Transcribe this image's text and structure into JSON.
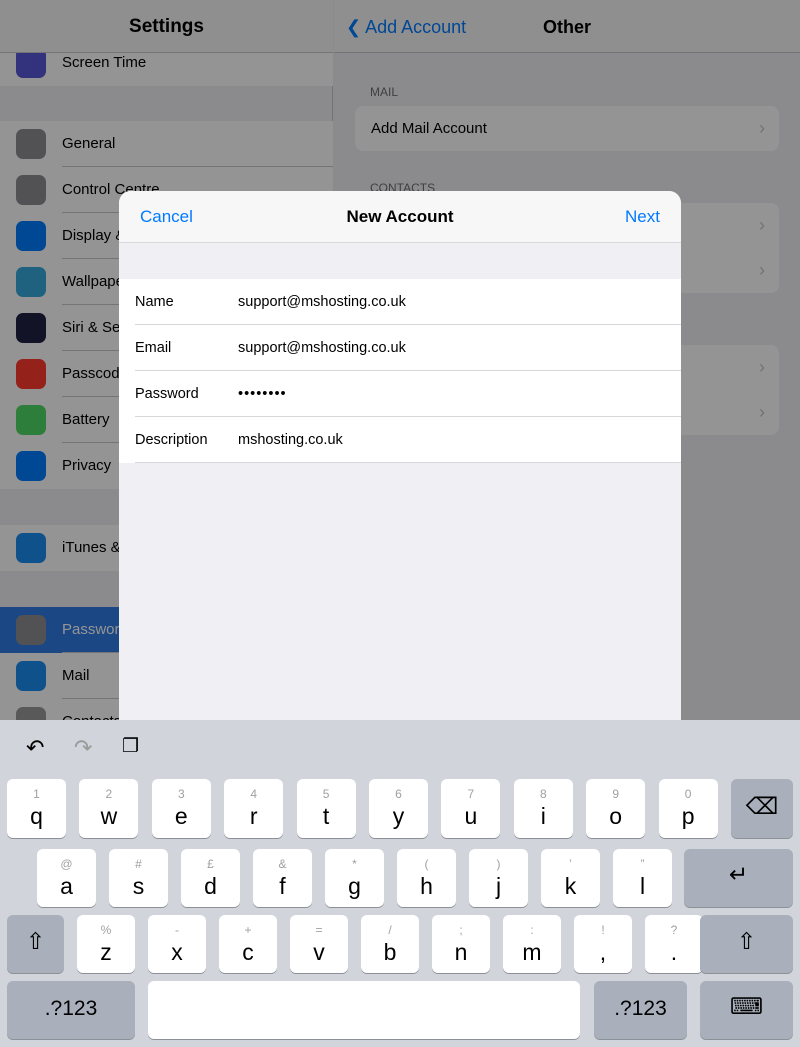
{
  "sidebar": {
    "title": "Settings",
    "items": [
      {
        "label": "Screen Time",
        "icon": "hourglass-icon",
        "color": "#5856d6"
      },
      {
        "label": "General",
        "icon": "gear-icon",
        "color": "#8e8e93"
      },
      {
        "label": "Control Centre",
        "icon": "toggles-icon",
        "color": "#8e8e93"
      },
      {
        "label": "Display & Brightness",
        "icon": "text-size-icon",
        "color": "#007aff"
      },
      {
        "label": "Wallpaper",
        "icon": "flower-icon",
        "color": "#34aadc"
      },
      {
        "label": "Siri & Search",
        "icon": "siri-icon",
        "color": "#222244"
      },
      {
        "label": "Passcode",
        "icon": "lock-icon",
        "color": "#ff3b30"
      },
      {
        "label": "Battery",
        "icon": "battery-icon",
        "color": "#4cd964"
      },
      {
        "label": "Privacy",
        "icon": "hand-icon",
        "color": "#007aff"
      },
      {
        "label": "iTunes & App Store",
        "icon": "app-store-icon",
        "color": "#1a8cf0"
      },
      {
        "label": "Passwords & Accounts",
        "icon": "key-icon",
        "color": "#8e8e93",
        "selected": true
      },
      {
        "label": "Mail",
        "icon": "envelope-icon",
        "color": "#1a8cf0"
      },
      {
        "label": "Contacts",
        "icon": "contacts-icon",
        "color": "#9a9a9a"
      }
    ]
  },
  "detail": {
    "back_label": "Add Account",
    "title": "Other",
    "mail_section": "MAIL",
    "add_mail": "Add Mail Account",
    "contacts_section": "CONTACTS"
  },
  "modal": {
    "cancel": "Cancel",
    "title": "New Account",
    "next": "Next",
    "fields": [
      {
        "label": "Name",
        "value": "support@mshosting.co.uk"
      },
      {
        "label": "Email",
        "value": "support@mshosting.co.uk"
      },
      {
        "label": "Password",
        "value": "••••••••"
      },
      {
        "label": "Description",
        "value": "mshosting.co.uk"
      }
    ]
  },
  "keyboard": {
    "row1": [
      [
        "1",
        "q"
      ],
      [
        "2",
        "w"
      ],
      [
        "3",
        "e"
      ],
      [
        "4",
        "r"
      ],
      [
        "5",
        "t"
      ],
      [
        "6",
        "y"
      ],
      [
        "7",
        "u"
      ],
      [
        "8",
        "i"
      ],
      [
        "9",
        "o"
      ],
      [
        "0",
        "p"
      ]
    ],
    "row2": [
      [
        "@",
        "a"
      ],
      [
        "#",
        "s"
      ],
      [
        "£",
        "d"
      ],
      [
        "&",
        "f"
      ],
      [
        "*",
        "g"
      ],
      [
        "(",
        "h"
      ],
      [
        ")",
        "j"
      ],
      [
        "’",
        "k"
      ],
      [
        "”",
        "l"
      ]
    ],
    "row3": [
      [
        "%",
        "z"
      ],
      [
        "-",
        "x"
      ],
      [
        "+",
        "c"
      ],
      [
        "=",
        "v"
      ],
      [
        "/",
        "b"
      ],
      [
        ";",
        "n"
      ],
      [
        ":",
        "m"
      ],
      [
        "!",
        ","
      ],
      [
        "?",
        "."
      ]
    ],
    "numbers_label": ".?123",
    "delete_icon": "⌫",
    "return_icon": "↵",
    "shift_icon": "⇧",
    "hide_icon": "⌨",
    "undo_icon": "↶",
    "redo_icon": "↷",
    "paste_icon": "❐"
  }
}
